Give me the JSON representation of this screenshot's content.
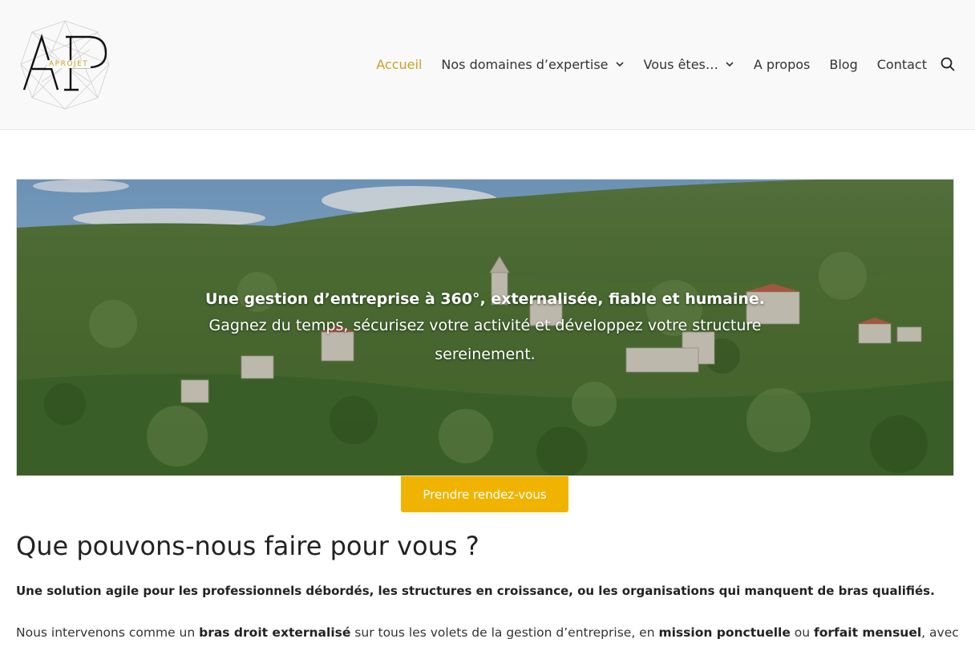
{
  "header": {
    "logo_text": "APROJET",
    "logo_letters": "AP",
    "nav": [
      {
        "label": "Accueil",
        "active": true,
        "has_dropdown": false
      },
      {
        "label": "Nos domaines d’expertise",
        "active": false,
        "has_dropdown": true
      },
      {
        "label": "Vous êtes…",
        "active": false,
        "has_dropdown": true
      },
      {
        "label": "A propos",
        "active": false,
        "has_dropdown": false
      },
      {
        "label": "Blog",
        "active": false,
        "has_dropdown": false
      },
      {
        "label": "Contact",
        "active": false,
        "has_dropdown": false
      }
    ],
    "search_icon": "search-icon",
    "accent_color": "#c9a227"
  },
  "hero": {
    "title": "Une gestion d’entreprise à 360°, externalisée, fiable et humaine.",
    "subtitle": "Gagnez du temps, sécurisez votre activité et développez votre structure sereinement.",
    "image": "hillside-village-photo"
  },
  "cta": {
    "label": "Prendre rendez-vous",
    "color": "#f0b400"
  },
  "main": {
    "heading": "Que pouvons-nous faire pour vous ?",
    "lead": "Une solution agile pour les professionnels débordés, les structures en croissance, ou les organisations qui manquent de bras qualifiés.",
    "para": {
      "t1": "Nous intervenons comme un ",
      "b1": "bras droit externalisé",
      "t2": " sur tous les volets de la gestion d’entreprise, en ",
      "b2": "mission ponctuelle",
      "t3": " ou ",
      "b3": "forfait mensuel",
      "t4": ", avec"
    }
  }
}
